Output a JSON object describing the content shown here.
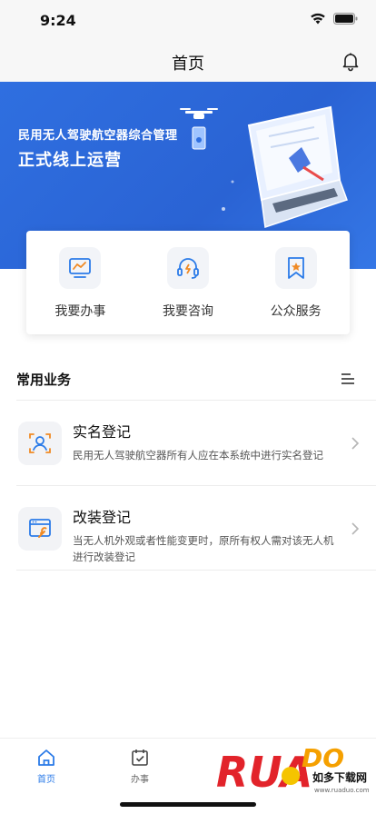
{
  "status_bar": {
    "time": "9:24"
  },
  "nav": {
    "title": "首页"
  },
  "banner": {
    "line1": "民用无人驾驶航空器综合管理",
    "line2": "正式线上运营"
  },
  "quick_actions": [
    {
      "label": "我要办事",
      "icon": "chart-monitor-icon"
    },
    {
      "label": "我要咨询",
      "icon": "headset-icon"
    },
    {
      "label": "公众服务",
      "icon": "bookmark-star-icon"
    }
  ],
  "section": {
    "title": "常用业务"
  },
  "business_items": [
    {
      "title": "实名登记",
      "desc": "民用无人驾驶航空器所有人应在本系统中进行实名登记",
      "icon": "id-scan-icon"
    },
    {
      "title": "改装登记",
      "desc": "当无人机外观或者性能变更时，原所有权人需对该无人机进行改装登记",
      "icon": "window-wrench-icon"
    }
  ],
  "tabs": [
    {
      "label": "首页",
      "icon": "home-icon",
      "active": true
    },
    {
      "label": "办事",
      "icon": "calendar-check-icon",
      "active": false
    }
  ],
  "watermark": {
    "brand": "RUANDADO",
    "cn": "如多下载网",
    "url": "www.ruaduo.com"
  },
  "colors": {
    "primary": "#2f6fe0",
    "icon_blue": "#2b7be8",
    "icon_orange": "#f08a24",
    "tab_active": "#2b7be8",
    "tab_inactive": "#666666"
  }
}
